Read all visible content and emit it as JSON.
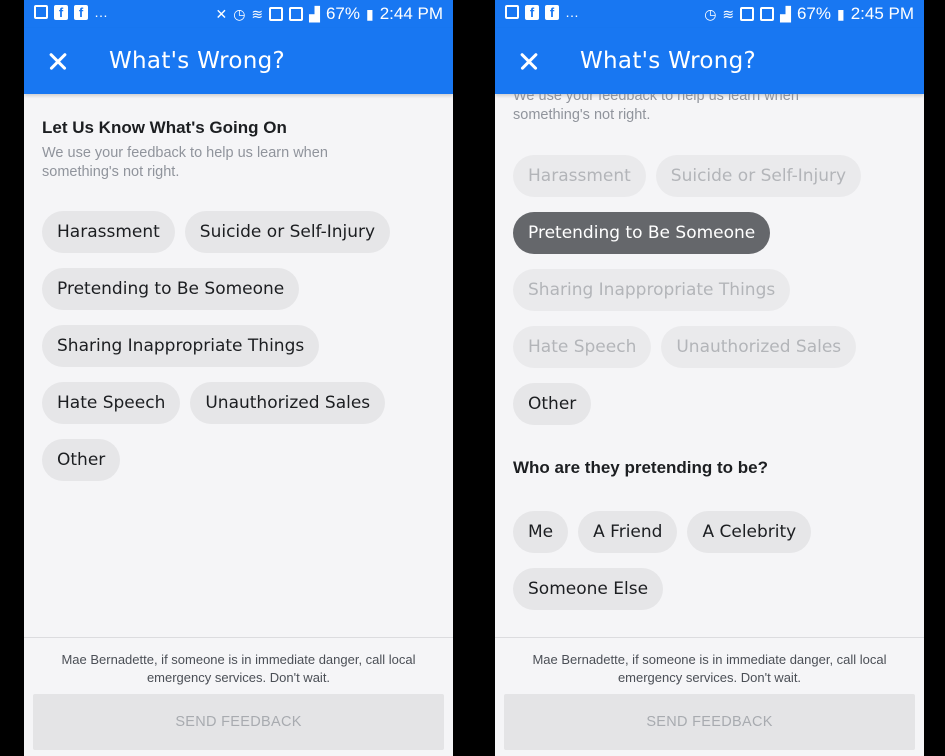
{
  "left": {
    "status": {
      "time": "2:44 PM",
      "battery": "67%"
    },
    "appbar": {
      "title": "What's Wrong?"
    },
    "section": {
      "title": "Let Us Know What's Going On",
      "description": "We use your feedback to help us learn when something's not right."
    },
    "options": [
      [
        "Harassment",
        "Suicide or Self-Injury"
      ],
      [
        "Pretending to Be Someone"
      ],
      [
        "Sharing Inappropriate Things"
      ],
      [
        "Hate Speech",
        "Unauthorized Sales"
      ],
      [
        "Other"
      ]
    ],
    "footer": {
      "note": "Mae Bernadette, if someone is in immediate danger, call local emergency services. Don't wait.",
      "send_label": "SEND FEEDBACK"
    }
  },
  "right": {
    "status": {
      "time": "2:45 PM",
      "battery": "67%"
    },
    "appbar": {
      "title": "What's Wrong?"
    },
    "section": {
      "description": "We use your feedback to help us learn when something's not right."
    },
    "options": [
      [
        "Harassment",
        "Suicide or Self-Injury"
      ],
      [
        "Pretending to Be Someone"
      ],
      [
        "Sharing Inappropriate Things"
      ],
      [
        "Hate Speech",
        "Unauthorized Sales"
      ],
      [
        "Other"
      ]
    ],
    "selected_option": "Pretending to Be Someone",
    "followup": {
      "title": "Who are they pretending to be?",
      "options": [
        [
          "Me",
          "A Friend",
          "A Celebrity"
        ],
        [
          "Someone Else"
        ]
      ]
    },
    "footer": {
      "note": "Mae Bernadette, if someone is in immediate danger, call local emergency services. Don't wait.",
      "send_label": "SEND FEEDBACK"
    }
  },
  "colors": {
    "brand": "#1877f2",
    "chip": "#e6e6e8",
    "chip_selected": "#65676b"
  }
}
